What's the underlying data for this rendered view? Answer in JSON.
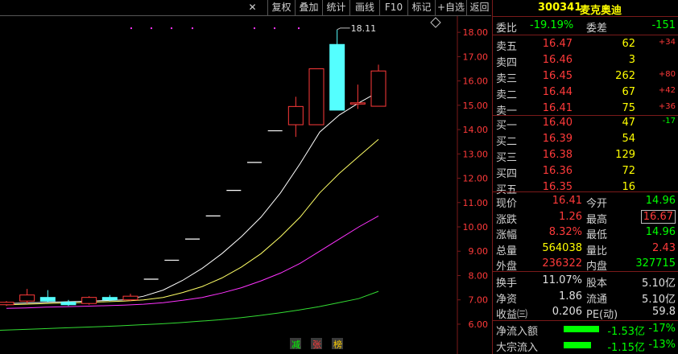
{
  "toolbar": {
    "buttons": [
      "复权",
      "叠加",
      "统计",
      "画线",
      "F10",
      "标记",
      "+自选",
      "返回"
    ],
    "close": "✕"
  },
  "chart_data": {
    "type": "candlestick",
    "ylim": [
      5.7,
      18.6
    ],
    "yticks": [
      "18.00",
      "17.00",
      "16.00",
      "15.00",
      "14.00",
      "13.00",
      "12.00",
      "11.00",
      "10.00",
      "9.00",
      "8.00",
      "7.00",
      "6.00"
    ],
    "high_label": "18.11",
    "bottom_labels": [
      {
        "text": "减",
        "color": "#00ff00"
      },
      {
        "text": "张",
        "color": "#ff3a3a"
      },
      {
        "text": "榜",
        "color": "#ffd000"
      }
    ],
    "candles": [
      {
        "o": 6.8,
        "c": 6.9,
        "h": 6.95,
        "l": 6.75
      },
      {
        "o": 6.95,
        "c": 7.2,
        "h": 7.45,
        "l": 6.85
      },
      {
        "o": 7.1,
        "c": 6.95,
        "h": 7.4,
        "l": 6.9
      },
      {
        "o": 6.9,
        "c": 6.8,
        "h": 7.0,
        "l": 6.75
      },
      {
        "o": 6.85,
        "c": 7.1,
        "h": 7.15,
        "l": 6.8
      },
      {
        "o": 7.1,
        "c": 7.0,
        "h": 7.2,
        "l": 6.95
      },
      {
        "o": 7.0,
        "c": 7.15,
        "h": 7.25,
        "l": 6.95
      },
      {
        "o": 7.85,
        "c": 7.85,
        "h": 7.85,
        "l": 7.85
      },
      {
        "o": 8.63,
        "c": 8.63,
        "h": 8.63,
        "l": 8.63
      },
      {
        "o": 9.5,
        "c": 9.5,
        "h": 9.5,
        "l": 9.5
      },
      {
        "o": 10.45,
        "c": 10.45,
        "h": 10.45,
        "l": 10.45
      },
      {
        "o": 11.5,
        "c": 11.5,
        "h": 11.5,
        "l": 11.5
      },
      {
        "o": 12.65,
        "c": 12.65,
        "h": 12.65,
        "l": 12.65
      },
      {
        "o": 13.95,
        "c": 13.95,
        "h": 13.95,
        "l": 13.95
      },
      {
        "o": 14.2,
        "c": 14.95,
        "h": 15.35,
        "l": 13.7
      },
      {
        "o": 14.2,
        "c": 16.5,
        "h": 16.5,
        "l": 14.2
      },
      {
        "o": 17.5,
        "c": 14.8,
        "h": 18.11,
        "l": 14.8
      },
      {
        "o": 15.05,
        "c": 15.1,
        "h": 15.85,
        "l": 14.85
      },
      {
        "o": 14.96,
        "c": 16.41,
        "h": 16.67,
        "l": 14.96
      }
    ],
    "series": [
      {
        "color": "#ffffff",
        "values": [
          6.85,
          6.87,
          6.9,
          6.92,
          6.94,
          6.97,
          7.0,
          7.15,
          7.4,
          7.8,
          8.3,
          8.9,
          9.6,
          10.4,
          11.4,
          12.6,
          13.9,
          14.6,
          15.1,
          15.55
        ]
      },
      {
        "color": "#ffff66",
        "values": [
          6.8,
          6.82,
          6.85,
          6.87,
          6.89,
          6.92,
          6.95,
          7.0,
          7.1,
          7.3,
          7.55,
          7.9,
          8.35,
          8.9,
          9.6,
          10.4,
          11.4,
          12.2,
          12.9,
          13.6
        ]
      },
      {
        "color": "#ff33ff",
        "values": [
          6.65,
          6.67,
          6.7,
          6.72,
          6.74,
          6.76,
          6.78,
          6.82,
          6.88,
          6.98,
          7.1,
          7.28,
          7.5,
          7.78,
          8.1,
          8.5,
          9.0,
          9.5,
          10.0,
          10.45
        ]
      },
      {
        "color": "#33dd33",
        "values": [
          5.75,
          5.78,
          5.81,
          5.84,
          5.87,
          5.9,
          5.93,
          5.97,
          6.01,
          6.06,
          6.12,
          6.18,
          6.26,
          6.35,
          6.46,
          6.58,
          6.72,
          6.88,
          7.05,
          7.35
        ]
      }
    ],
    "dots_y": 18.2
  },
  "quote": {
    "code": "300341",
    "name": "麦克奥迪",
    "weibi_label": "委比",
    "weibi": "-19.19%",
    "weicha_label": "委差",
    "weicha": "-151",
    "asks": [
      {
        "label": "卖五",
        "price": "16.47",
        "vol": "62",
        "chg": "+34"
      },
      {
        "label": "卖四",
        "price": "16.46",
        "vol": "3",
        "chg": ""
      },
      {
        "label": "卖三",
        "price": "16.45",
        "vol": "262",
        "chg": "+80"
      },
      {
        "label": "卖二",
        "price": "16.44",
        "vol": "67",
        "chg": "+42"
      },
      {
        "label": "卖一",
        "price": "16.41",
        "vol": "75",
        "chg": "+36"
      }
    ],
    "bids": [
      {
        "label": "买一",
        "price": "16.40",
        "vol": "47",
        "chg": "-17"
      },
      {
        "label": "买二",
        "price": "16.39",
        "vol": "54",
        "chg": ""
      },
      {
        "label": "买三",
        "price": "16.38",
        "vol": "129",
        "chg": ""
      },
      {
        "label": "买四",
        "price": "16.36",
        "vol": "72",
        "chg": ""
      },
      {
        "label": "买五",
        "price": "16.35",
        "vol": "16",
        "chg": ""
      }
    ],
    "stats": [
      {
        "l1": "现价",
        "v1": "16.41",
        "c1": "red",
        "l2": "今开",
        "v2": "14.96",
        "c2": "green"
      },
      {
        "l1": "涨跌",
        "v1": "1.26",
        "c1": "red",
        "l2": "最高",
        "v2": "16.67",
        "c2": "red",
        "box": true
      },
      {
        "l1": "涨幅",
        "v1": "8.32%",
        "c1": "red",
        "l2": "最低",
        "v2": "14.96",
        "c2": "green"
      },
      {
        "l1": "总量",
        "v1": "564038",
        "c1": "yellow",
        "l2": "量比",
        "v2": "2.43",
        "c2": "red"
      },
      {
        "l1": "外盘",
        "v1": "236322",
        "c1": "red",
        "l2": "内盘",
        "v2": "327715",
        "c2": "green"
      }
    ],
    "stats2": [
      {
        "l1": "换手",
        "v1": "11.07%",
        "l2": "股本",
        "v2": "5.10亿"
      },
      {
        "l1": "净资",
        "v1": "1.86",
        "l2": "流通",
        "v2": "5.10亿"
      },
      {
        "l1": "收益㈢",
        "v1": "0.206",
        "l2": "PE(动)",
        "v2": "59.8"
      }
    ],
    "flows": [
      {
        "label": "净流入额",
        "value": "-1.53亿",
        "pct": "-17%",
        "bar": 0.17
      },
      {
        "label": "大宗流入",
        "value": "-1.15亿",
        "pct": "-13%",
        "bar": 0.13
      }
    ]
  }
}
